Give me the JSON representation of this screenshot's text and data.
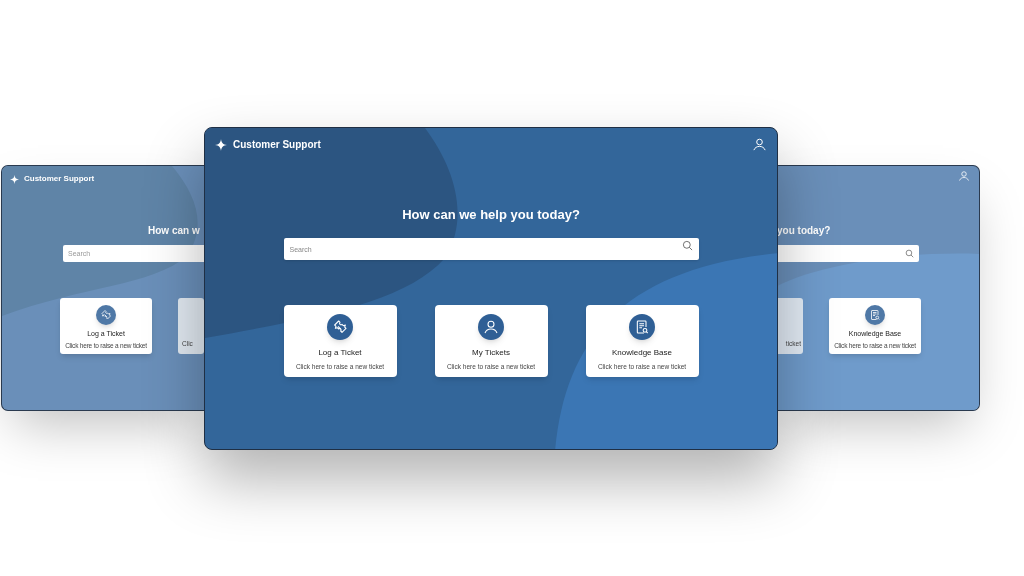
{
  "left_window": {
    "title": "Customer Support",
    "heading": "How can w",
    "search": {
      "placeholder": "Search"
    },
    "cards": [
      {
        "title": "Log a Ticket",
        "subtitle": "Click here to raise a new ticket"
      },
      {
        "subtitle": "Clic"
      }
    ]
  },
  "main_window": {
    "title": "Customer Support",
    "heading": "How can we help you today?",
    "search": {
      "placeholder": "Search"
    },
    "cards": [
      {
        "title": "Log a Ticket",
        "subtitle": "Click here to raise a new ticket"
      },
      {
        "title": "My Tickets",
        "subtitle": "Click here to raise a new ticket"
      },
      {
        "title": "Knowledge Base",
        "subtitle": "Click here to raise a new ticket"
      }
    ]
  },
  "right_window": {
    "heading": "you today?",
    "cards": [
      {
        "subtitle": "ticket"
      },
      {
        "title": "Knowledge Base",
        "subtitle": "Click here to raise a new ticket"
      }
    ]
  }
}
